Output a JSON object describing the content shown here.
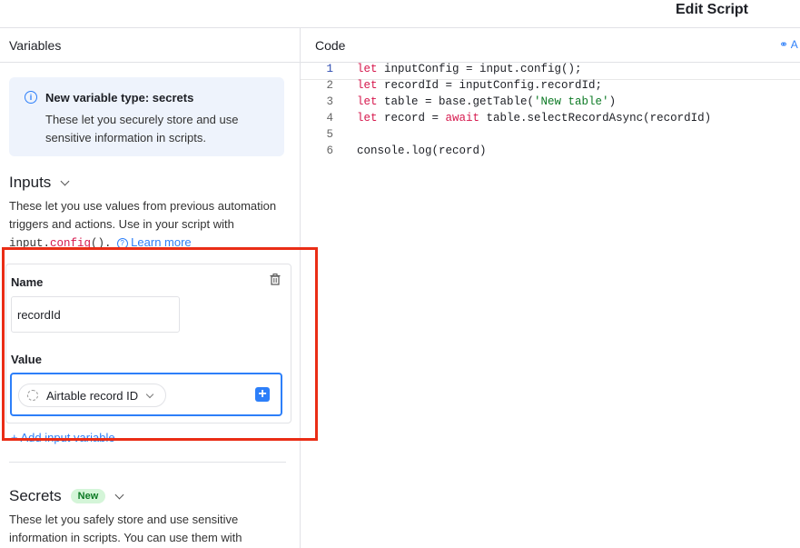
{
  "header": {
    "title": "Edit Script"
  },
  "left_panel": {
    "title": "Variables",
    "info": {
      "icon": "info-icon",
      "title": "New variable type: secrets",
      "body": "These let you securely store and use sensitive information in scripts."
    },
    "inputs": {
      "title": "Inputs",
      "desc_prefix": "These let you use values from previous automation triggers and actions. Use in your script with ",
      "code_a": "input.",
      "code_b": "config",
      "code_c": "().",
      "learn_more": "Learn more",
      "card": {
        "name_label": "Name",
        "name_value": "recordId",
        "value_label": "Value",
        "value_pill": "Airtable record ID"
      },
      "add_input": "+ Add input variable"
    },
    "secrets": {
      "title": "Secrets",
      "badge": "New",
      "desc": "These let you safely store and use sensitive information in scripts. You can use them with"
    }
  },
  "right_panel": {
    "title": "Code",
    "collab_label": "A",
    "code_lines": [
      {
        "n": "1",
        "parts": [
          [
            "kw",
            "let"
          ],
          [
            "t",
            " inputConfig = input.config();"
          ]
        ]
      },
      {
        "n": "2",
        "parts": [
          [
            "kw",
            "let"
          ],
          [
            "t",
            " recordId = inputConfig.recordId;"
          ]
        ]
      },
      {
        "n": "3",
        "parts": [
          [
            "kw",
            "let"
          ],
          [
            "t",
            " table = base.getTable("
          ],
          [
            "str",
            "'New table'"
          ],
          [
            "t",
            ")"
          ]
        ]
      },
      {
        "n": "4",
        "parts": [
          [
            "kw",
            "let"
          ],
          [
            "t",
            " record = "
          ],
          [
            "kw",
            "await"
          ],
          [
            "t",
            " table.selectRecordAsync(recordId)"
          ]
        ]
      },
      {
        "n": "5",
        "parts": []
      },
      {
        "n": "6",
        "parts": [
          [
            "t",
            "console.log(record)"
          ]
        ]
      }
    ]
  },
  "colors": {
    "accent": "#2d7ff9",
    "highlight": "#ea2d16",
    "keyword": "#d6184d",
    "string": "#0d7a25"
  }
}
